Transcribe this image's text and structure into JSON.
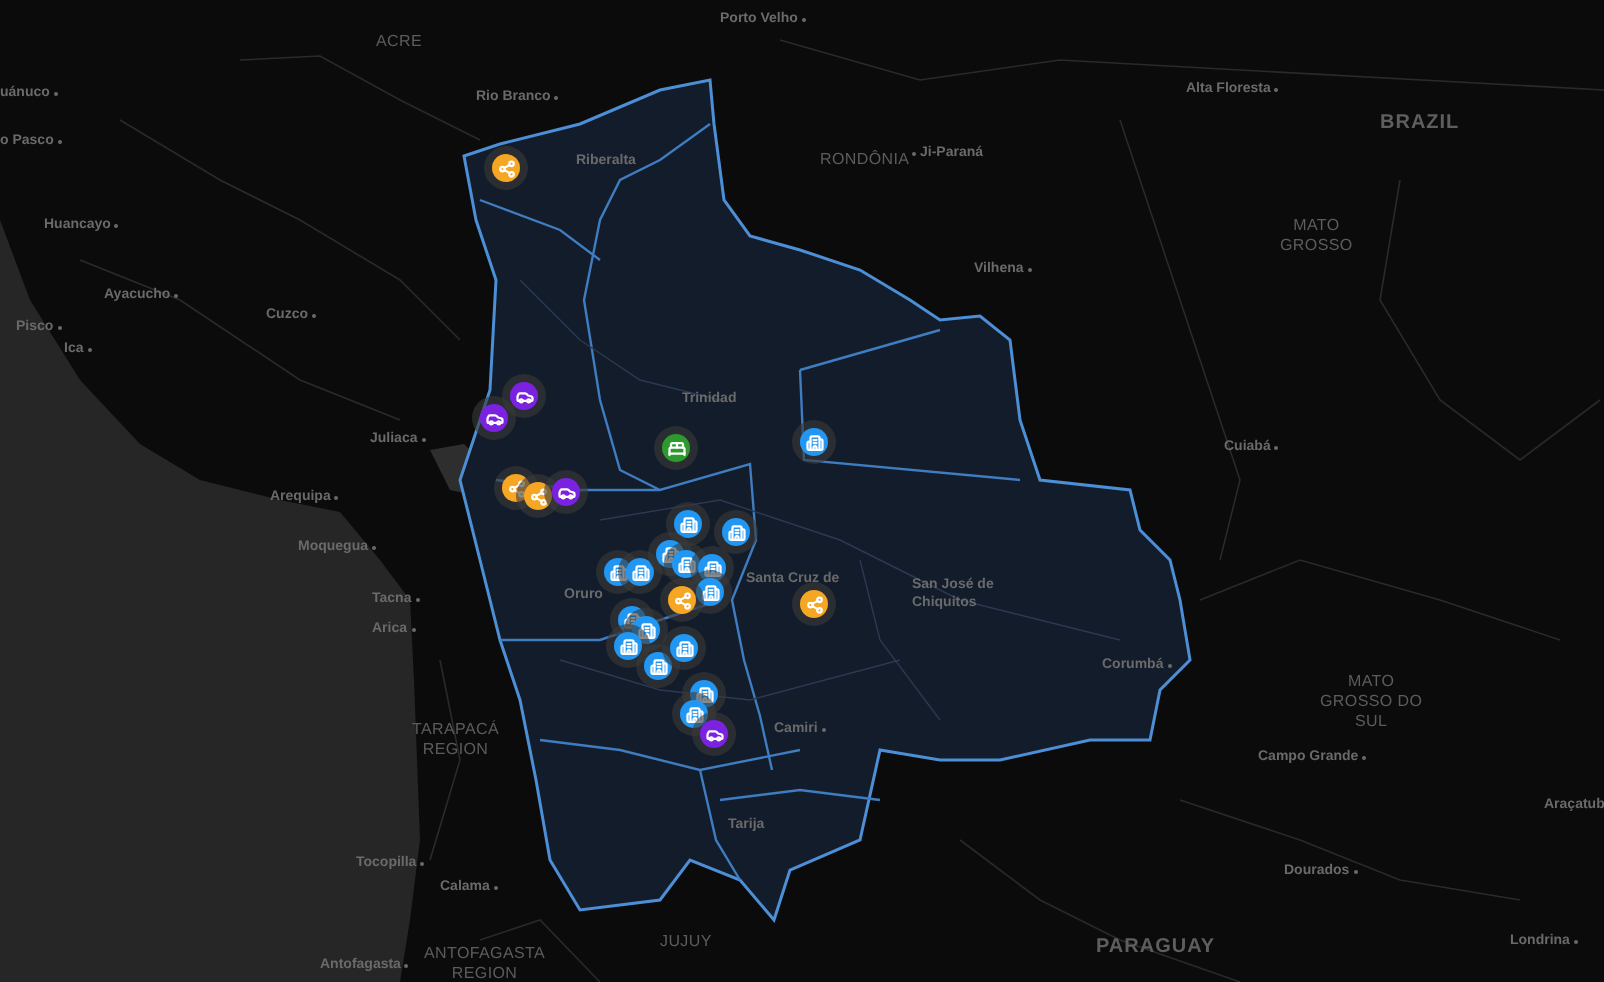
{
  "map": {
    "labels": [
      {
        "text": "ACRE",
        "kind": "region"
      },
      {
        "text": "Rio Branco",
        "kind": "city"
      },
      {
        "text": "Porto Velho",
        "kind": "city"
      },
      {
        "text": "uánuco",
        "kind": "city"
      },
      {
        "text": "o Pasco",
        "kind": "city"
      },
      {
        "text": "Huancayo",
        "kind": "city"
      },
      {
        "text": "Ayacucho",
        "kind": "city"
      },
      {
        "text": "Pisco",
        "kind": "city"
      },
      {
        "text": "Ica",
        "kind": "city"
      },
      {
        "text": "Cuzco",
        "kind": "city"
      },
      {
        "text": "Juliaca",
        "kind": "city"
      },
      {
        "text": "Riberalta",
        "kind": "place"
      },
      {
        "text": "RONDÔNIA",
        "kind": "region"
      },
      {
        "text": "Ji-Paraná",
        "kind": "eastcity"
      },
      {
        "text": "Vilhena",
        "kind": "city"
      },
      {
        "text": "Trinidad",
        "kind": "place"
      },
      {
        "text": "Alta Floresta",
        "kind": "city"
      },
      {
        "text": "BRAZIL",
        "kind": "country"
      },
      {
        "text": "MATO\nGROSSO",
        "kind": "region"
      },
      {
        "text": "Cuiabá",
        "kind": "city"
      },
      {
        "text": "Arequipa",
        "kind": "city"
      },
      {
        "text": "Moquegua",
        "kind": "city"
      },
      {
        "text": "Tacna",
        "kind": "city"
      },
      {
        "text": "Arica",
        "kind": "city"
      },
      {
        "text": "TARAPACÁ\nREGION",
        "kind": "region"
      },
      {
        "text": "Tocopilla",
        "kind": "city"
      },
      {
        "text": "Calama",
        "kind": "city"
      },
      {
        "text": "Antofagasta",
        "kind": "city"
      },
      {
        "text": "ANTOFAGASTA\nREGION",
        "kind": "region"
      },
      {
        "text": "Oruro",
        "kind": "place"
      },
      {
        "text": "Santa Cruz de",
        "kind": "place"
      },
      {
        "text": "San José de\nChiquitos",
        "kind": "place"
      },
      {
        "text": "Camiri",
        "kind": "city"
      },
      {
        "text": "Tarija",
        "kind": "place"
      },
      {
        "text": "Corumbá",
        "kind": "city"
      },
      {
        "text": "MATO\nGROSSO DO\nSUL",
        "kind": "region"
      },
      {
        "text": "Campo Grande",
        "kind": "city"
      },
      {
        "text": "Araçatub",
        "kind": "place"
      },
      {
        "text": "Dourados",
        "kind": "city"
      },
      {
        "text": "JUJUY",
        "kind": "region"
      },
      {
        "text": "PARAGUAY",
        "kind": "country"
      },
      {
        "text": "Londrina",
        "kind": "city"
      }
    ],
    "markers": [
      {
        "kind": "share",
        "color": "#f5a623"
      },
      {
        "kind": "car",
        "color": "#7b22e0"
      },
      {
        "kind": "car",
        "color": "#7b22e0"
      },
      {
        "kind": "bed",
        "color": "#2e9a2e"
      },
      {
        "kind": "building",
        "color": "#2196f3"
      },
      {
        "kind": "share",
        "color": "#f5a623"
      },
      {
        "kind": "share",
        "color": "#f5a623"
      },
      {
        "kind": "car",
        "color": "#7b22e0"
      },
      {
        "kind": "building",
        "color": "#2196f3"
      },
      {
        "kind": "building",
        "color": "#2196f3"
      },
      {
        "kind": "building",
        "color": "#2196f3"
      },
      {
        "kind": "building",
        "color": "#2196f3"
      },
      {
        "kind": "building",
        "color": "#2196f3"
      },
      {
        "kind": "building",
        "color": "#2196f3"
      },
      {
        "kind": "building",
        "color": "#2196f3"
      },
      {
        "kind": "building",
        "color": "#2196f3"
      },
      {
        "kind": "share",
        "color": "#f5a623"
      },
      {
        "kind": "share",
        "color": "#f5a623"
      },
      {
        "kind": "building",
        "color": "#2196f3"
      },
      {
        "kind": "building",
        "color": "#2196f3"
      },
      {
        "kind": "building",
        "color": "#2196f3"
      },
      {
        "kind": "building",
        "color": "#2196f3"
      },
      {
        "kind": "building",
        "color": "#2196f3"
      },
      {
        "kind": "building",
        "color": "#2196f3"
      },
      {
        "kind": "building",
        "color": "#2196f3"
      },
      {
        "kind": "car",
        "color": "#7b22e0"
      }
    ]
  }
}
